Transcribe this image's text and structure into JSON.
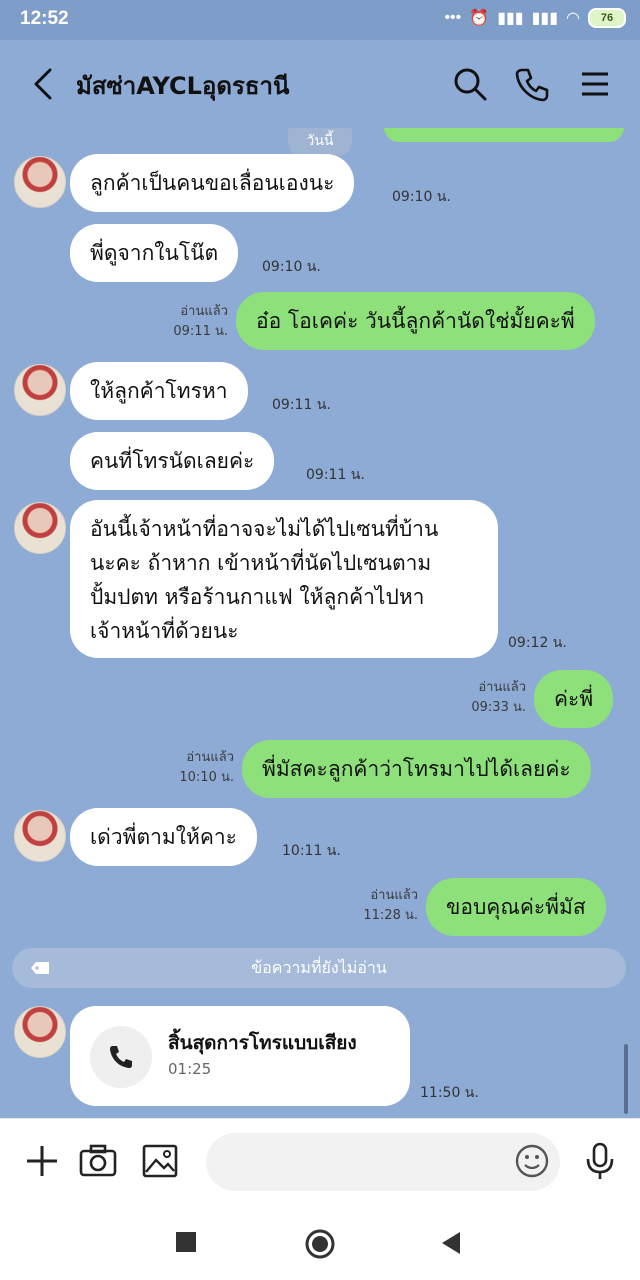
{
  "status_bar": {
    "time": "12:52",
    "battery": "76"
  },
  "header": {
    "title": "มัสซ่าAYCLอุดรธานี"
  },
  "chat": {
    "date_label": "วันนี้",
    "messages": [
      {
        "side": "in",
        "text": "ลูกค้าเป็นคนขอเลื่อนเองนะ",
        "time": "09:10 น."
      },
      {
        "side": "in",
        "text": "พี่ดูจากในโน๊ต",
        "time": "09:10 น."
      },
      {
        "side": "out",
        "text": "อ๋อ โอเคค่ะ วันนี้ลูกค้านัดใช่มั้ยคะพี่",
        "read": "อ่านแล้ว",
        "time": "09:11 น."
      },
      {
        "side": "in",
        "text": "ให้ลูกค้าโทรหา",
        "time": "09:11 น."
      },
      {
        "side": "in",
        "text": "คนที่โทรนัดเลยค่ะ",
        "time": "09:11 น."
      },
      {
        "side": "in",
        "lines": [
          "อันนี้เจ้าหน้าที่อาจจะไม่ได้ไปเซนที่บ้าน",
          "นะคะ ถ้าหาก เข้าหน้าที่นัดไปเซนตาม",
          "ปั้มปตท หรือร้านกาแฟ ให้ลูกค้าไปหา",
          "เจ้าหน้าที่ด้วยนะ"
        ],
        "time": "09:12 น."
      },
      {
        "side": "out",
        "text": "ค่ะพี่",
        "read": "อ่านแล้ว",
        "time": "09:33 น."
      },
      {
        "side": "out",
        "text": "พี่มัสคะลูกค้าว่าโทรมาไปได้เลยค่ะ",
        "read": "อ่านแล้ว",
        "time": "10:10 น."
      },
      {
        "side": "in",
        "text": "เด่วพี่ตามให้คาะ",
        "time": "10:11 น."
      },
      {
        "side": "out",
        "text": "ขอบคุณค่ะพี่มัส",
        "read": "อ่านแล้ว",
        "time": "11:28 น."
      }
    ],
    "unread_label": "ข้อความที่ยังไม่อ่าน",
    "call": {
      "title": "สิ้นสุดการโทรแบบเสียง",
      "duration": "01:25",
      "time": "11:50 น."
    }
  },
  "colors": {
    "chat_bg": "#8eabd6",
    "outgoing_bubble": "#8de07a",
    "incoming_bubble": "#ffffff"
  },
  "icons": [
    "back-icon",
    "search-icon",
    "phone-icon",
    "menu-icon",
    "plus-icon",
    "camera-icon",
    "image-icon",
    "emoji-icon",
    "microphone-icon"
  ]
}
